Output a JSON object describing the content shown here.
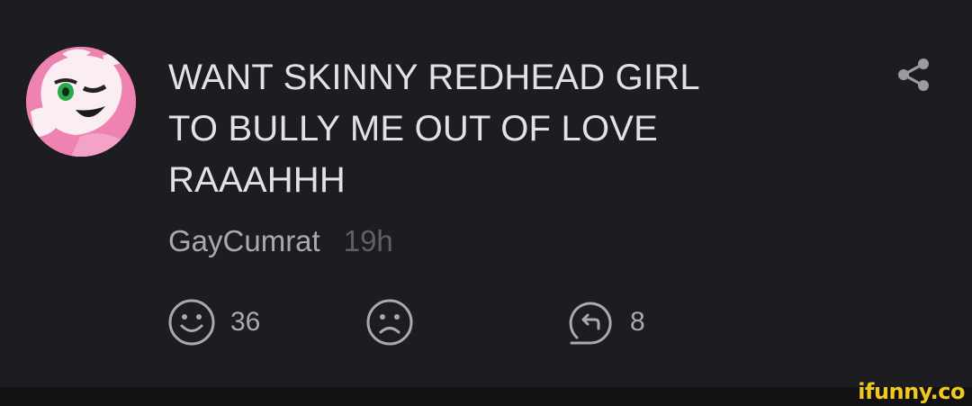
{
  "comment": {
    "line1": "WANT SKINNY REDHEAD GIRL",
    "line2": "TO BULLY ME OUT OF LOVE",
    "line3": "RAAAHHH"
  },
  "author": {
    "username": "GayCumrat",
    "time": "19h",
    "avatar_icon": "anime-character-avatar"
  },
  "actions": {
    "smile_icon": "smile-icon",
    "smile_count": "36",
    "frown_icon": "frown-icon",
    "reply_icon": "reply-icon",
    "reply_count": "8",
    "share_icon": "share-icon"
  },
  "watermark": "ifunny.co",
  "colors": {
    "background": "#1c1c21",
    "text_primary": "#e2e2e6",
    "text_secondary": "#a9a9b0",
    "text_muted": "#5f5f66",
    "watermark": "#f2c81c"
  }
}
